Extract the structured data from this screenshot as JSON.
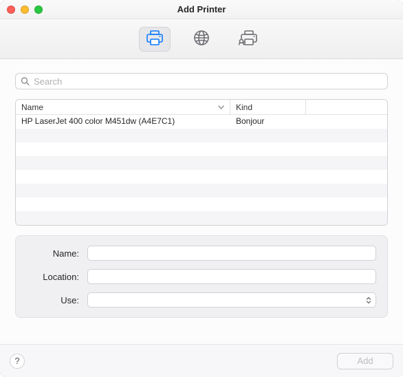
{
  "window": {
    "title": "Add Printer"
  },
  "toolbar": {
    "tabs": [
      {
        "id": "default",
        "icon": "printer-local-icon",
        "active": true
      },
      {
        "id": "ip",
        "icon": "globe-icon",
        "active": false
      },
      {
        "id": "windows",
        "icon": "printer-share-icon",
        "active": false
      }
    ]
  },
  "search": {
    "placeholder": "Search",
    "value": ""
  },
  "list": {
    "columns": {
      "name": "Name",
      "kind": "Kind"
    },
    "rows": [
      {
        "name": "HP LaserJet 400 color M451dw (A4E7C1)",
        "kind": "Bonjour"
      },
      {
        "name": "",
        "kind": ""
      },
      {
        "name": "",
        "kind": ""
      },
      {
        "name": "",
        "kind": ""
      },
      {
        "name": "",
        "kind": ""
      },
      {
        "name": "",
        "kind": ""
      },
      {
        "name": "",
        "kind": ""
      },
      {
        "name": "",
        "kind": ""
      }
    ]
  },
  "form": {
    "labels": {
      "name": "Name:",
      "location": "Location:",
      "use": "Use:"
    },
    "values": {
      "name": "",
      "location": "",
      "use": ""
    }
  },
  "footer": {
    "help_label": "?",
    "add_label": "Add",
    "add_enabled": false
  }
}
